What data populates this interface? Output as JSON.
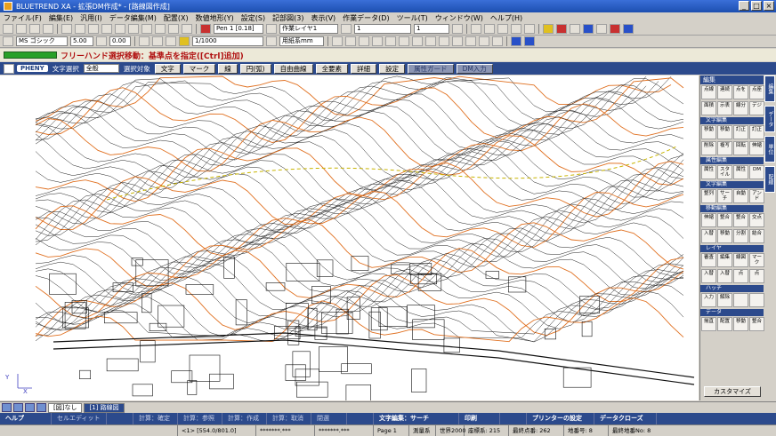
{
  "window": {
    "title": "BLUETREND XA - 拡張DM作成* - [路線図作成]"
  },
  "menu": [
    "ファイル(F)",
    "編集(E)",
    "汎用(I)",
    "データ編集(M)",
    "配置(X)",
    "数値地形(Y)",
    "設定(S)",
    "記部図(3)",
    "表示(V)",
    "作業データ(D)",
    "ツール(T)",
    "ウィンドウ(W)",
    "ヘルプ(H)"
  ],
  "toolbar1": {
    "pen": "Pen 1 [0.18]",
    "layer": "作業レイヤ1",
    "line_type": "1",
    "line_width": "1"
  },
  "toolbar2": {
    "font": "MS ゴシック",
    "font_size": "5.00",
    "angle": "0.00",
    "scale": "1/1000",
    "paper": "用紙系mm"
  },
  "message": "フリーハンド選択移動：基準点を指定([Ctrl]追加)",
  "mode": {
    "logo": "PHENY",
    "label": "文字選択",
    "select": "全般",
    "target_label": "選択対象",
    "buttons": [
      "文字",
      "マーク",
      "線",
      "円(弧)",
      "自由曲線",
      "全要素",
      "詳細",
      "設定",
      "属性ガード",
      "DM入力"
    ]
  },
  "palette": {
    "title": "編集",
    "sections": [
      {
        "name": "",
        "items": [
          "点線",
          "連続",
          "点を",
          "点座"
        ]
      },
      {
        "name": "",
        "items": [
          "面積",
          "示表",
          "線分",
          "デジ"
        ]
      },
      {
        "name": "文字編集",
        "items": [
          "移動",
          "移動",
          "訂正",
          "訂正"
        ]
      },
      {
        "name": "",
        "items": [
          "削除",
          "複写",
          "回転",
          "伸縮"
        ]
      },
      {
        "name": "属性編集",
        "items": [
          "属性",
          "スタイル",
          "属性",
          "DM"
        ]
      },
      {
        "name": "文字編集",
        "items": [
          "整列",
          "サーチ",
          "自動",
          "アンド"
        ]
      },
      {
        "name": "移動編集",
        "items": [
          "伸縮",
          "整合",
          "整合",
          "交点"
        ]
      },
      {
        "name": "",
        "items": [
          "入替",
          "移動",
          "分割",
          "結合"
        ]
      },
      {
        "name": "レイヤ",
        "items": [
          "審査",
          "編集",
          "線図",
          "マーク"
        ]
      },
      {
        "name": "",
        "items": [
          "入替",
          "入替",
          "点",
          "点"
        ]
      },
      {
        "name": "ハッチ",
        "items": [
          "入力",
          "解除",
          "",
          ""
        ]
      },
      {
        "name": "データ",
        "items": [
          "揃直",
          "配置",
          "移動",
          "整合"
        ]
      }
    ],
    "customize": "カスタマイズ"
  },
  "vtabs": [
    "編集",
    "データ",
    "単位",
    "配線"
  ],
  "tabs": [
    "[図]なし",
    "[1] 路線図"
  ],
  "fkeys": [
    "ヘルプ",
    "セルエディット",
    "",
    "計算：確定",
    "計算：参照",
    "計算：作成",
    "計算：取消",
    "閉選",
    "",
    "文字編集：サーチ",
    "印刷",
    "",
    "プリンターの設定",
    "データクローズ"
  ],
  "status": {
    "coords": "<1> [554.0/801.0]",
    "x": "*******.***",
    "y": "*******.***",
    "page": "Page 1",
    "system": "測量系",
    "datum": "世界2000",
    "zone_label": "座標系:",
    "zone": "215",
    "points_label": "最終点番:",
    "points": "262",
    "ground_label": "地番号:",
    "ground": "8",
    "last_label": "最終地番No:",
    "last": "8"
  },
  "axis": {
    "x": "X",
    "y": "Y"
  }
}
